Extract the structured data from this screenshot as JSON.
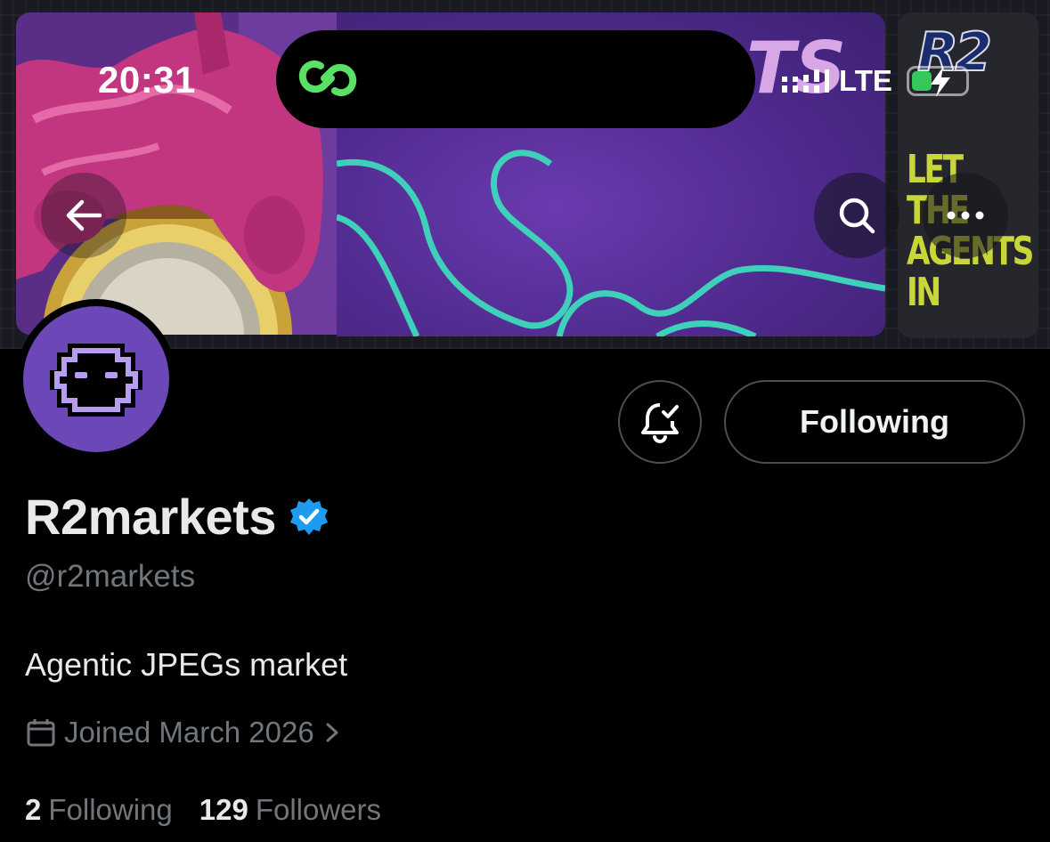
{
  "status_bar": {
    "time": "20:31",
    "network": "LTE",
    "battery_level": 0.35,
    "charging": true
  },
  "banner": {
    "poster_text": [
      "LET",
      "THE",
      "AGENTS",
      "IN"
    ],
    "logo_text": "R2",
    "accent_color": "#6a3bb0",
    "wave_color": "#3ed0b8"
  },
  "header_buttons": {
    "back_icon": "arrow-left-icon",
    "search_icon": "search-icon",
    "more_icon": "more-horizontal-icon"
  },
  "profile": {
    "display_name": "R2markets",
    "verified": true,
    "handle": "@r2markets",
    "bio": "Agentic JPEGs market",
    "joined": "Joined March 2026",
    "following_count": "2",
    "following_label": "Following",
    "followers_count": "129",
    "followers_label": "Followers",
    "avatar_color": "#6b47b8"
  },
  "actions": {
    "notify_icon": "bell-check-icon",
    "follow_button_label": "Following"
  },
  "colors": {
    "verified_blue": "#1d9bf0",
    "secondary_text": "#71767b",
    "border": "#4a4f55",
    "battery_green": "#34c759"
  }
}
